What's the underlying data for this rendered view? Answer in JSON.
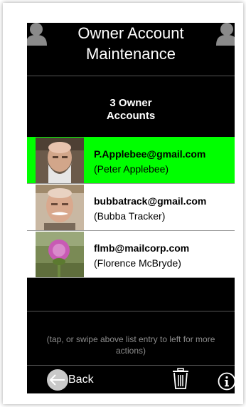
{
  "header": {
    "title": "Owner Account\nMaintenance"
  },
  "summary": {
    "count_label": "3 Owner\nAccounts"
  },
  "accounts": [
    {
      "email": "P.Applebee@gmail.com",
      "name": "(Peter Applebee)",
      "selected": true
    },
    {
      "email": "bubbatrack@gmail.com",
      "name": "(Bubba Tracker)",
      "selected": false
    },
    {
      "email": "flmb@mailcorp.com",
      "name": "(Florence McBryde)",
      "selected": false
    }
  ],
  "hint": "(tap, or swipe above list entry to left for more actions)",
  "footer": {
    "back_label": "Back",
    "trash_icon": "trash-icon",
    "info_icon": "info-icon"
  },
  "colors": {
    "background": "#000000",
    "selected_row": "#00ff00",
    "row": "#ffffff",
    "hint_text": "#8c8c8c"
  }
}
